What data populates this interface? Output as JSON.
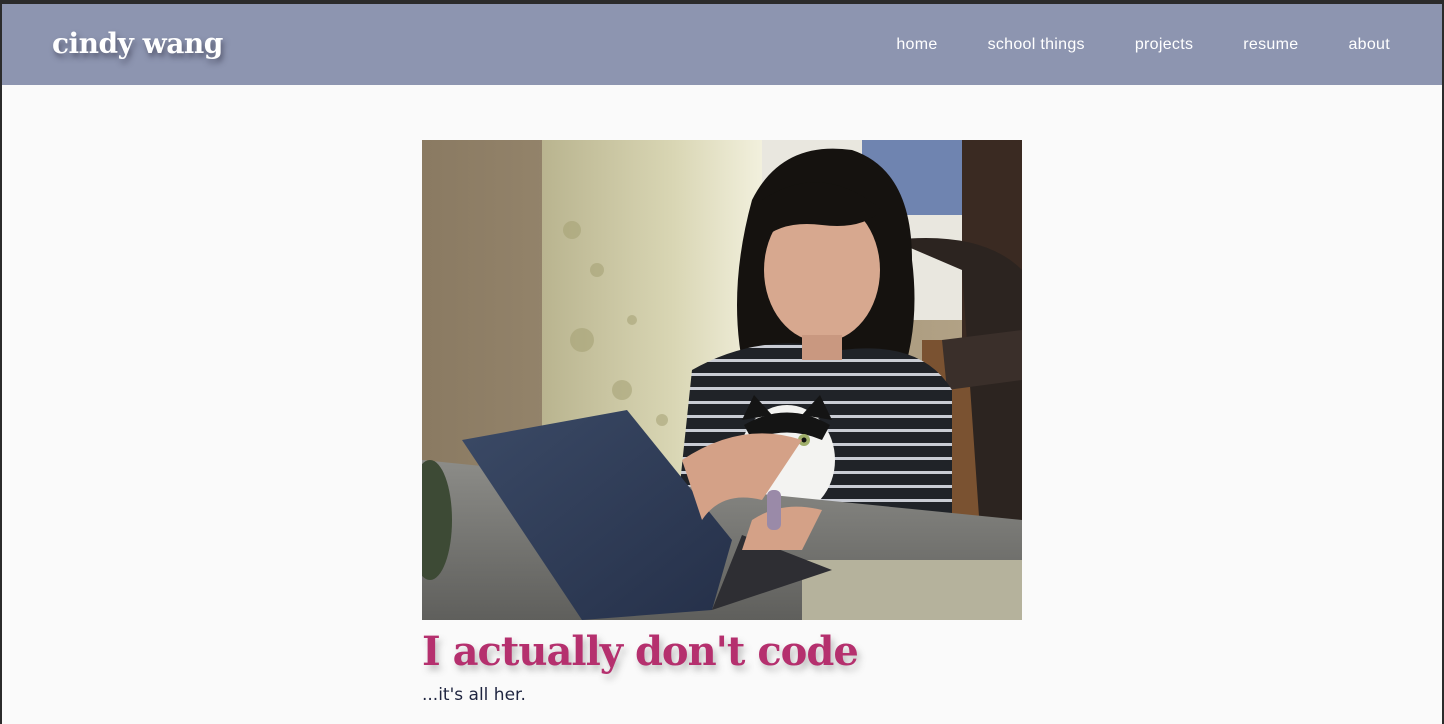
{
  "header": {
    "brand": "cindy wang",
    "nav": [
      {
        "label": "home"
      },
      {
        "label": "school things"
      },
      {
        "label": "projects"
      },
      {
        "label": "resume"
      },
      {
        "label": "about",
        "active": true
      }
    ],
    "background_color": "#8d95b0"
  },
  "main": {
    "photo": {
      "subject": "person typing on a laptop with a black-and-white cat on her lap"
    },
    "headline": "I actually don't code",
    "caption": "...it's all her.",
    "headline_color": "#b5306e"
  }
}
